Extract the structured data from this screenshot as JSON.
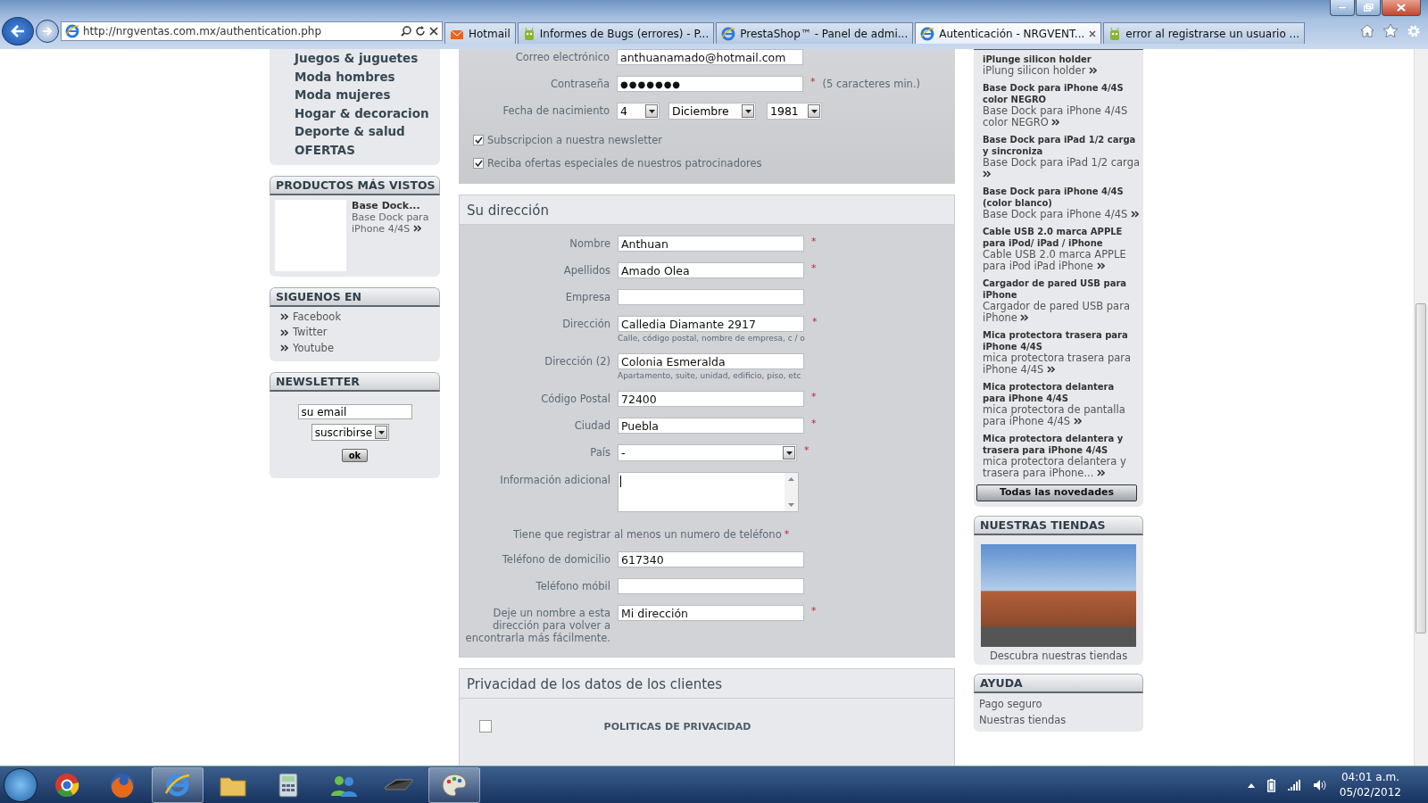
{
  "browser": {
    "address": "http://nrgventas.com.mx/authentication.php",
    "tabs": [
      {
        "title": "Hotmail",
        "kind": "mail",
        "selected": false
      },
      {
        "title": "Informes de Bugs (errores) - P...",
        "kind": "forum",
        "selected": false
      },
      {
        "title": "PrestaShop™ - Panel de admi...",
        "kind": "ie",
        "selected": false
      },
      {
        "title": "Autenticación - NRGVENT...",
        "kind": "ie",
        "selected": true
      },
      {
        "title": "error al registrarse un usuario ...",
        "kind": "forum",
        "selected": false
      }
    ]
  },
  "left": {
    "categories": [
      "Juegos & juguetes",
      "Moda hombres",
      "Moda mujeres",
      "Hogar & decoracion",
      "Deporte & salud",
      "OFERTAS"
    ],
    "most_viewed": {
      "title": "PRODUCTOS MÁS VISTOS",
      "name": "Base Dock...",
      "description": "Base Dock para iPhone 4/4S"
    },
    "follow": {
      "title": "SIGUENOS EN",
      "links": [
        "Facebook",
        "Twitter",
        "Youtube"
      ]
    },
    "newsletter": {
      "title": "NEWSLETTER",
      "email": "su email",
      "action": "suscribirse",
      "button": "ok"
    }
  },
  "account": {
    "email_label": "Correo electrónico",
    "email": "anthuanamado@hotmail.com",
    "password_label": "Contraseña",
    "password": "●●●●●●●",
    "password_mark": "*",
    "password_hint": "(5 caracteres min.)",
    "birth_label": "Fecha de nacimiento",
    "day": "4",
    "month": "Diciembre",
    "year": "1981",
    "checkboxes": [
      {
        "label": "Subscripcion a nuestra newsletter",
        "checked": true
      },
      {
        "label": "Reciba ofertas especiales de nuestros patrocinadores",
        "checked": true
      }
    ]
  },
  "address": {
    "title": "Su dirección",
    "fields": [
      {
        "kind": "text",
        "label": "Nombre",
        "value": "Anthuan",
        "mark": "*"
      },
      {
        "kind": "text",
        "label": "Apellidos",
        "value": "Amado Olea",
        "mark": "*"
      },
      {
        "kind": "text",
        "label": "Empresa"
      },
      {
        "kind": "text",
        "label": "Dirección",
        "value": "Calledia Diamante 2917",
        "mark": "*",
        "hint": "Calle, código postal, nombre de empresa, c / o"
      },
      {
        "kind": "text",
        "label": "Dirección (2)",
        "value": "Colonia Esmeralda",
        "hint": "Apartamento, suite, unidad, edificio, piso, etc"
      },
      {
        "kind": "text",
        "label": "Código Postal",
        "value": "72400",
        "mark": "*"
      },
      {
        "kind": "text",
        "label": "Ciudad",
        "value": "Puebla",
        "mark": "*"
      },
      {
        "kind": "select",
        "label": "País",
        "value": "-",
        "mark": "*"
      },
      {
        "kind": "textarea",
        "label": "Información adicional"
      },
      {
        "kind": "note",
        "label": "Tiene que registrar al menos un numero de teléfono",
        "mark": "*"
      },
      {
        "kind": "text",
        "label": "Teléfono de domicilio",
        "value": "617340"
      },
      {
        "kind": "text",
        "label": "Teléfono móbil"
      },
      {
        "kind": "text",
        "label": "Deje un nombre a esta dirección para volver a encontrarla más fácilmente.",
        "value": "Mi dirección",
        "mark": "*"
      }
    ]
  },
  "privacy": {
    "title": "Privacidad de los datos de los clientes",
    "checked": false,
    "label": "POLITICAS DE PRIVACIDAD"
  },
  "right": {
    "new_products": [
      {
        "name": "iPlunge silicon holder",
        "description": "iPlung silicon holder"
      },
      {
        "name": "Base Dock para iPhone 4/4S color NEGRO",
        "description": "Base Dock para iPhone 4/4S color NEGRO"
      },
      {
        "name": "Base Dock para iPad 1/2 carga y sincroniza",
        "description": "Base Dock para iPad 1/2 carga"
      },
      {
        "name": "Base Dock para iPhone 4/4S (color blanco)",
        "description": "Base Dock para iPhone 4/4S"
      },
      {
        "name": "Cable USB 2.0 marca APPLE para iPod/ iPad / iPhone",
        "description": "Cable USB 2.0 marca APPLE para iPod iPad iPhone"
      },
      {
        "name": "Cargador de pared USB para iPhone",
        "description": "Cargador de pared USB para iPhone"
      },
      {
        "name": "Mica protectora trasera para iPhone 4/4S",
        "description": "mica protectora trasera para iPhone 4/4S"
      },
      {
        "name": "Mica protectora delantera para iPhone 4/4S",
        "description": "mica protectora de pantalla para iPhone 4/4S"
      },
      {
        "name": "Mica protectora delantera y trasera para iPhone 4/4S",
        "description": "mica protectora delantera y trasera para iPhone..."
      }
    ],
    "all_button": "Todas las novedades",
    "stores": {
      "title": "NUESTRAS TIENDAS",
      "caption": "Descubra nuestras tiendas"
    },
    "help": {
      "title": "AYUDA",
      "links": [
        "Pago seguro",
        "Nuestras tiendas"
      ]
    }
  },
  "taskbar": {
    "time": "04:01 a.m.",
    "date": "05/02/2012"
  }
}
